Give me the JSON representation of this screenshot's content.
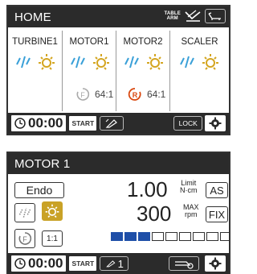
{
  "home": {
    "title": "HOME",
    "table_arm": [
      "TABLE",
      "ARM"
    ],
    "instruments": [
      {
        "name": "TURBINE1"
      },
      {
        "name": "MOTOR1",
        "direction": "F",
        "ratio": "64:1"
      },
      {
        "name": "MOTOR2",
        "direction": "R",
        "ratio": "64:1"
      },
      {
        "name": "SCALER"
      }
    ],
    "timer": "00:00",
    "start_label": "START",
    "lock_label": "LOCK"
  },
  "motor": {
    "title": "MOTOR 1",
    "mode": "Endo",
    "torque_value": "1.00",
    "torque_label_1": "Limit",
    "torque_label_2": "N·cm",
    "as_label": "AS",
    "speed_value": "300",
    "speed_label_1": "MAX",
    "speed_label_2": "rpm",
    "fix_label": "FIX",
    "direction": "F",
    "ratio": "1:1",
    "level": {
      "filled": 3,
      "total": 10
    },
    "timer": "00:00",
    "start_label": "START",
    "program_number": "1"
  },
  "colors": {
    "dark": "#2b2b2b",
    "spray_blue": "#3aa0d8",
    "light_yellow": "#d4a520",
    "reverse_red": "#d9480f",
    "level_blue": "#1f4fa8"
  }
}
